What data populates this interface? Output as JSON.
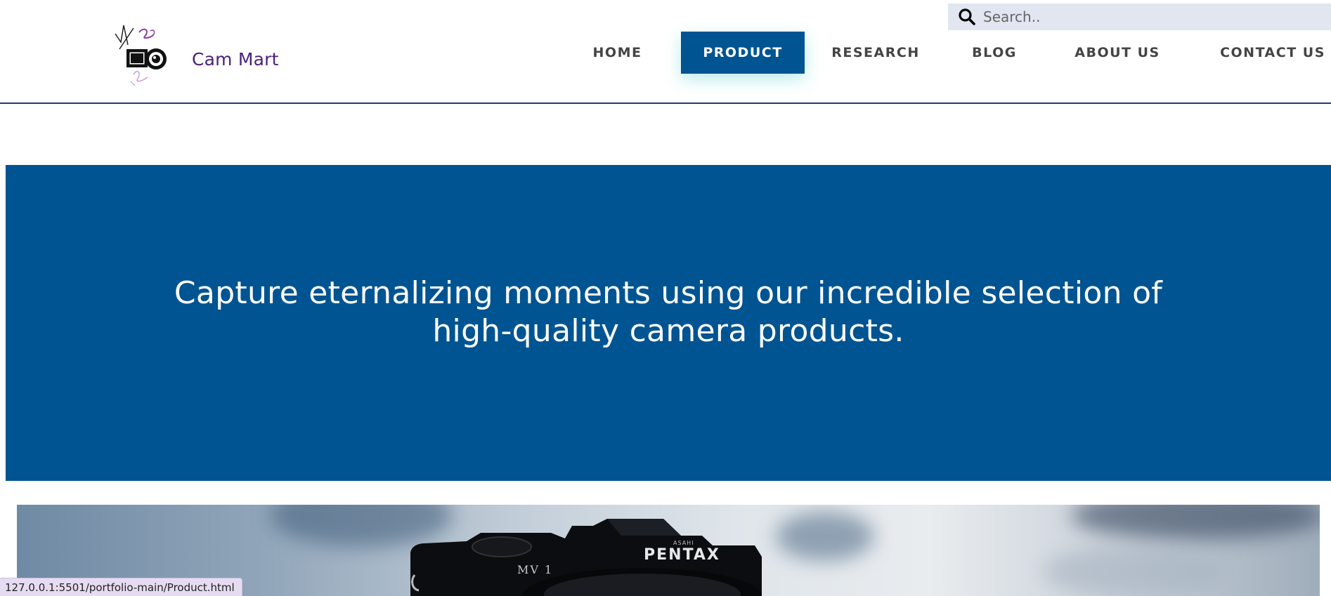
{
  "brand": {
    "name": "Cam Mart"
  },
  "search": {
    "placeholder": "Search.."
  },
  "nav": {
    "items": [
      {
        "label": "HOME"
      },
      {
        "label": "PRODUCT",
        "active": true
      },
      {
        "label": "RESEARCH"
      },
      {
        "label": "BLOG"
      },
      {
        "label": "ABOUT US"
      },
      {
        "label": "CONTACT US"
      }
    ]
  },
  "hero": {
    "text": "Capture eternalizing moments using our incredible selection of high-quality camera products."
  },
  "product_image": {
    "camera_labels": {
      "brand": "PENTAX",
      "model": "MV 1",
      "maker": "ASAHI"
    }
  },
  "status_bar": {
    "url": "127.0.0.1:5501/portfolio-main/Product.html"
  },
  "colors": {
    "primary": "#005492",
    "brand_text": "#4b1f7e",
    "nav_text": "#444444",
    "search_bg": "#e1e6f1",
    "header_border": "#1f3a6a"
  },
  "icons": {
    "search": "search-icon",
    "logo": "camera-logo"
  }
}
